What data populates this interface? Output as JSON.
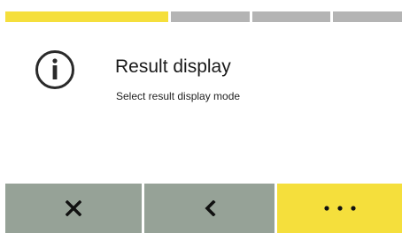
{
  "progress": {
    "steps": 4,
    "current_step": 1
  },
  "header": {
    "icon": "info-icon",
    "title": "Result display",
    "subtitle": "Select result display mode"
  },
  "buttons": {
    "cancel_icon": "close-icon",
    "back_icon": "chevron-left-icon",
    "more_icon": "more-dots-icon"
  },
  "colors": {
    "accent_yellow": "#f5df3c",
    "button_gray": "#96a297",
    "progress_inactive": "#b4b4b4"
  }
}
